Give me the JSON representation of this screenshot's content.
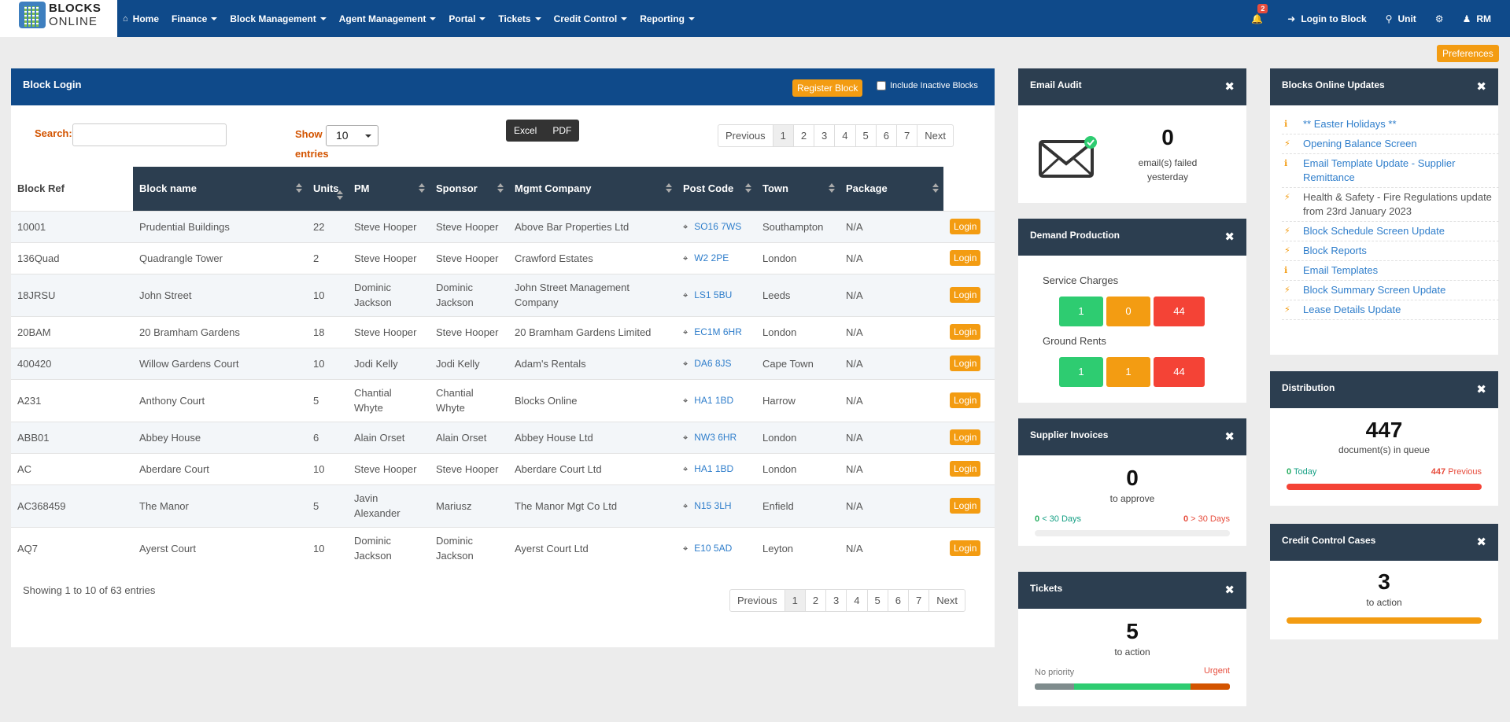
{
  "logo": {
    "line1": "BLOCKS",
    "line2": "ONLINE"
  },
  "nav": {
    "items": [
      {
        "label": "Home",
        "icon": "home-icon",
        "caret": false
      },
      {
        "label": "Finance",
        "caret": true
      },
      {
        "label": "Block Management",
        "caret": true
      },
      {
        "label": "Agent Management",
        "caret": true
      },
      {
        "label": "Portal",
        "caret": true
      },
      {
        "label": "Tickets",
        "caret": true
      },
      {
        "label": "Credit Control",
        "caret": true
      },
      {
        "label": "Reporting",
        "caret": true
      }
    ],
    "notifications_count": "2",
    "login_to_block": "Login to Block",
    "unit": "Unit",
    "user": "RM"
  },
  "preferences_label": "Preferences",
  "block_login": {
    "title": "Block Login",
    "register_label": "Register Block",
    "inactive_label": "Include Inactive Blocks",
    "search_label": "Search:",
    "search_value": "",
    "show_label": "Show",
    "entries_label": "entries",
    "page_size": "10",
    "export": {
      "excel": "Excel",
      "pdf": "PDF"
    },
    "pager": [
      "Previous",
      "1",
      "2",
      "3",
      "4",
      "5",
      "6",
      "7",
      "Next"
    ],
    "columns": [
      "Block Ref",
      "Block name",
      "Units",
      "PM",
      "Sponsor",
      "Mgmt Company",
      "Post Code",
      "Town",
      "Package"
    ],
    "rows": [
      {
        "ref": "10001",
        "name": "Prudential Buildings",
        "units": "22",
        "pm": "Steve Hooper",
        "sponsor": "Steve Hooper",
        "mgmt": "Above Bar Properties Ltd",
        "postcode": "SO16 7WS",
        "town": "Southampton",
        "package": "N/A"
      },
      {
        "ref": "136Quad",
        "name": "Quadrangle Tower",
        "units": "2",
        "pm": "Steve Hooper",
        "sponsor": "Steve Hooper",
        "mgmt": "Crawford Estates",
        "postcode": "W2 2PE",
        "town": "London",
        "package": "N/A"
      },
      {
        "ref": "18JRSU",
        "name": "John Street",
        "units": "10",
        "pm": "Dominic Jackson",
        "sponsor": "Dominic Jackson",
        "mgmt": "John Street Management Company",
        "postcode": "LS1 5BU",
        "town": "Leeds",
        "package": "N/A"
      },
      {
        "ref": "20BAM",
        "name": "20 Bramham Gardens",
        "units": "18",
        "pm": "Steve Hooper",
        "sponsor": "Steve Hooper",
        "mgmt": "20 Bramham Gardens Limited",
        "postcode": "EC1M 6HR",
        "town": "London",
        "package": "N/A"
      },
      {
        "ref": "400420",
        "name": "Willow Gardens Court",
        "units": "10",
        "pm": "Jodi Kelly",
        "sponsor": "Jodi Kelly",
        "mgmt": "Adam's Rentals",
        "postcode": "DA6 8JS",
        "town": "Cape Town",
        "package": "N/A"
      },
      {
        "ref": "A231",
        "name": "Anthony Court",
        "units": "5",
        "pm": "Chantial Whyte",
        "sponsor": "Chantial Whyte",
        "mgmt": "Blocks Online",
        "postcode": "HA1 1BD",
        "town": "Harrow",
        "package": "N/A"
      },
      {
        "ref": "ABB01",
        "name": "Abbey House",
        "units": "6",
        "pm": "Alain Orset",
        "sponsor": "Alain Orset",
        "mgmt": "Abbey House Ltd",
        "postcode": "NW3 6HR",
        "town": "London",
        "package": "N/A"
      },
      {
        "ref": "AC",
        "name": "Aberdare Court",
        "units": "10",
        "pm": "Steve Hooper",
        "sponsor": "Steve Hooper",
        "mgmt": "Aberdare Court Ltd",
        "postcode": "HA1 1BD",
        "town": "London",
        "package": "N/A"
      },
      {
        "ref": "AC368459",
        "name": "The Manor",
        "units": "5",
        "pm": "Javin Alexander",
        "sponsor": "Mariusz",
        "mgmt": "The Manor Mgt Co Ltd",
        "postcode": "N15 3LH",
        "town": "Enfield",
        "package": "N/A"
      },
      {
        "ref": "AQ7",
        "name": "Ayerst Court",
        "units": "10",
        "pm": "Dominic Jackson",
        "sponsor": "Dominic Jackson",
        "mgmt": "Ayerst Court Ltd",
        "postcode": "E10 5AD",
        "town": "Leyton",
        "package": "N/A"
      }
    ],
    "login_label": "Login",
    "showing": "Showing 1 to 10 of 63 entries"
  },
  "email_audit": {
    "title": "Email Audit",
    "count": "0",
    "line1": "email(s) failed",
    "line2": "yesterday"
  },
  "demand": {
    "title": "Demand Production",
    "service_label": "Service Charges",
    "service": [
      "1",
      "0",
      "44"
    ],
    "ground_label": "Ground Rents",
    "ground": [
      "1",
      "1",
      "44"
    ],
    "colors": [
      "#2ecc71",
      "#f39c12",
      "#f44336"
    ]
  },
  "supplier": {
    "title": "Supplier Invoices",
    "count": "0",
    "sub": "to approve",
    "left_num": "0",
    "left_txt": "< 30 Days",
    "right_num": "0",
    "right_txt": "> 30 Days"
  },
  "tickets": {
    "title": "Tickets",
    "count": "5",
    "sub": "to action",
    "left": "No priority",
    "right": "Urgent",
    "bar_fractions": [
      0.2,
      0.6,
      0.2
    ]
  },
  "updates": {
    "title": "Blocks Online Updates",
    "items": [
      {
        "icon": "info-icon",
        "text": "** Easter Holidays **",
        "link": true
      },
      {
        "icon": "bolt-icon",
        "text": "Opening Balance Screen",
        "link": true
      },
      {
        "icon": "info-icon",
        "text": "Email Template Update - Supplier Remittance",
        "link": true
      },
      {
        "icon": "bolt-icon",
        "text": "Health & Safety - Fire Regulations update from 23rd January 2023",
        "link": false
      },
      {
        "icon": "bolt-icon",
        "text": "Block Schedule Screen Update",
        "link": true
      },
      {
        "icon": "bolt-icon",
        "text": "Block Reports",
        "link": true
      },
      {
        "icon": "info-icon",
        "text": "Email Templates",
        "link": true
      },
      {
        "icon": "bolt-icon",
        "text": "Block Summary Screen Update",
        "link": true
      },
      {
        "icon": "bolt-icon",
        "text": "Lease Details Update",
        "link": true
      }
    ]
  },
  "distribution": {
    "title": "Distribution",
    "count": "447",
    "sub": "document(s) in queue",
    "today_num": "0",
    "today_txt": "Today",
    "prev_num": "447",
    "prev_txt": "Previous",
    "bar_fraction": 1.0
  },
  "credit": {
    "title": "Credit Control Cases",
    "count": "3",
    "sub": "to action",
    "bar_fraction": 1.0
  }
}
